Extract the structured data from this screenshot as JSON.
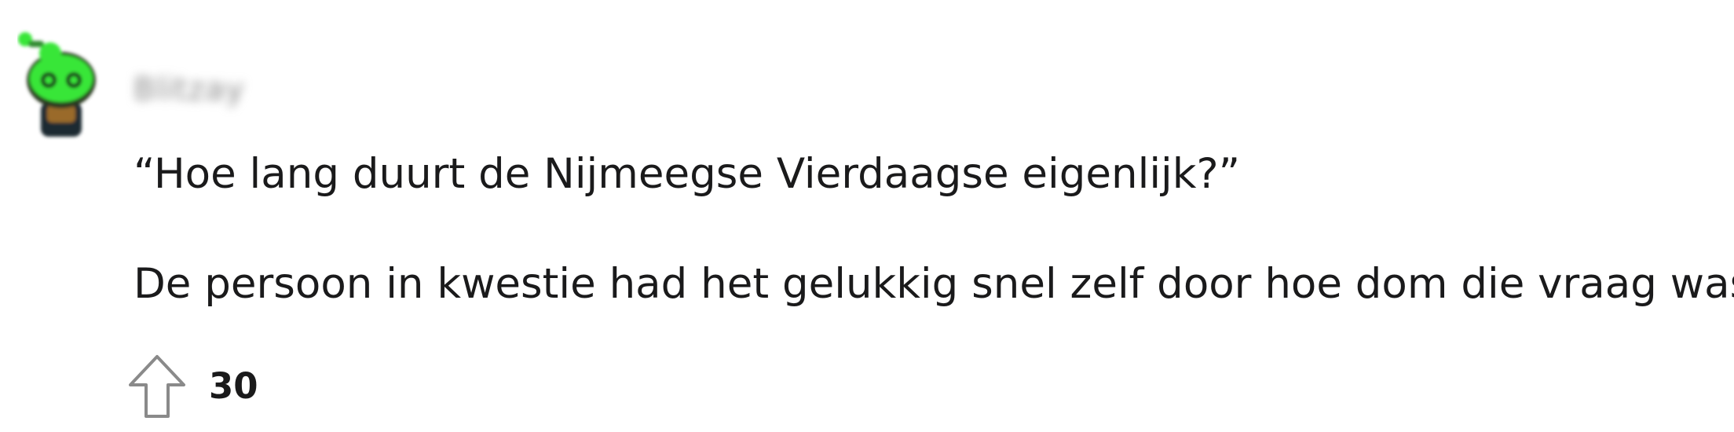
{
  "comment": {
    "author": "Blitzay",
    "body_lines": [
      "“Hoe lang duurt de Nijmeegse Vierdaagse eigenlijk?”",
      "De persoon in kwestie had het gelukkig snel zelf door hoe dom die vraag was."
    ],
    "score": "30"
  },
  "icons": {
    "upvote": "upvote-arrow-icon",
    "avatar": "snoo-avatar"
  },
  "colors": {
    "avatar_green": "#39e639",
    "avatar_dark": "#1f2a30",
    "avatar_brown": "#9a6a2a",
    "text": "#1a1a1b",
    "icon_stroke": "#8a8a8a"
  }
}
